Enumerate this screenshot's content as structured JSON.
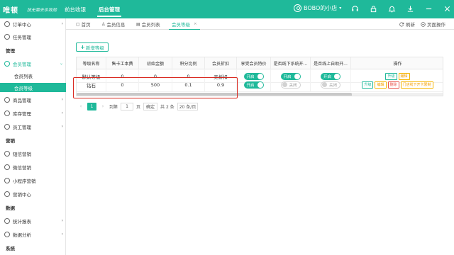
{
  "topbar": {
    "logo": "唯顿",
    "slogan": "技无需去杀致勋",
    "tabs": [
      "前台收银",
      "后台管理"
    ],
    "store_name": "BOBO的小店",
    "caret": "▾",
    "icons": [
      "headset-icon",
      "lock-icon",
      "bell-icon",
      "download-icon",
      "minimize-icon",
      "close-icon"
    ]
  },
  "sidebar": {
    "items": [
      {
        "label": "订单中心",
        "type": "menu",
        "arrow": "›"
      },
      {
        "label": "任务管理",
        "type": "menu"
      },
      {
        "label": "管理",
        "type": "section"
      },
      {
        "label": "会员管理",
        "type": "menu-active",
        "arrow": "⌄"
      },
      {
        "label": "会员列表",
        "type": "sub"
      },
      {
        "label": "会员等级",
        "type": "sub-current"
      },
      {
        "label": "商品管理",
        "type": "menu",
        "arrow": "›"
      },
      {
        "label": "库存管理",
        "type": "menu",
        "arrow": "›"
      },
      {
        "label": "员工管理",
        "type": "menu",
        "arrow": "›"
      },
      {
        "label": "营销",
        "type": "section"
      },
      {
        "label": "短信营销",
        "type": "menu"
      },
      {
        "label": "微信营销",
        "type": "menu"
      },
      {
        "label": "小程序营销",
        "type": "menu"
      },
      {
        "label": "营销中心",
        "type": "menu"
      },
      {
        "label": "数据",
        "type": "section"
      },
      {
        "label": "统计报表",
        "type": "menu",
        "arrow": "›"
      },
      {
        "label": "数据分析",
        "type": "menu",
        "arrow": "›"
      },
      {
        "label": "系统",
        "type": "section"
      }
    ]
  },
  "tabs": {
    "items": [
      {
        "label": "首页",
        "icon": "▢"
      },
      {
        "label": "会员信息",
        "icon": "♙"
      },
      {
        "label": "会员列表",
        "icon": "▤"
      },
      {
        "label": "会员等级",
        "icon": "",
        "close": "×"
      }
    ],
    "refresh": "刷新",
    "page_action": "页面操作"
  },
  "main": {
    "add_button": "新增等级",
    "table": {
      "headers": [
        "等级名称",
        "售卡工本费",
        "初始金额",
        "积分比例",
        "会员折扣",
        "享受会员特价",
        "是否线下系统开...",
        "是否线上自助开...",
        "操作"
      ],
      "rows": [
        {
          "name": "默认等级",
          "fee": "0",
          "init": "0",
          "points": "0",
          "discount": "无折扣",
          "special": "开启",
          "offline": "开启",
          "online": "开启",
          "ops": [
            "升级",
            "编辑"
          ]
        },
        {
          "name": "钻石",
          "fee": "0",
          "init": "500",
          "points": "0.1",
          "discount": "0.9",
          "special": "开启",
          "offline": "关闭",
          "online": "关闭",
          "ops": [
            "升级",
            "编辑",
            "删除",
            "门店线下开卡限制"
          ]
        }
      ]
    },
    "pager": {
      "prev": "‹",
      "page": "1",
      "next": "›",
      "goto_label": "到第",
      "goto_value": "1",
      "page_unit": "页",
      "confirm": "确定",
      "total": "共 2 条",
      "page_size": "20 条/页"
    }
  }
}
